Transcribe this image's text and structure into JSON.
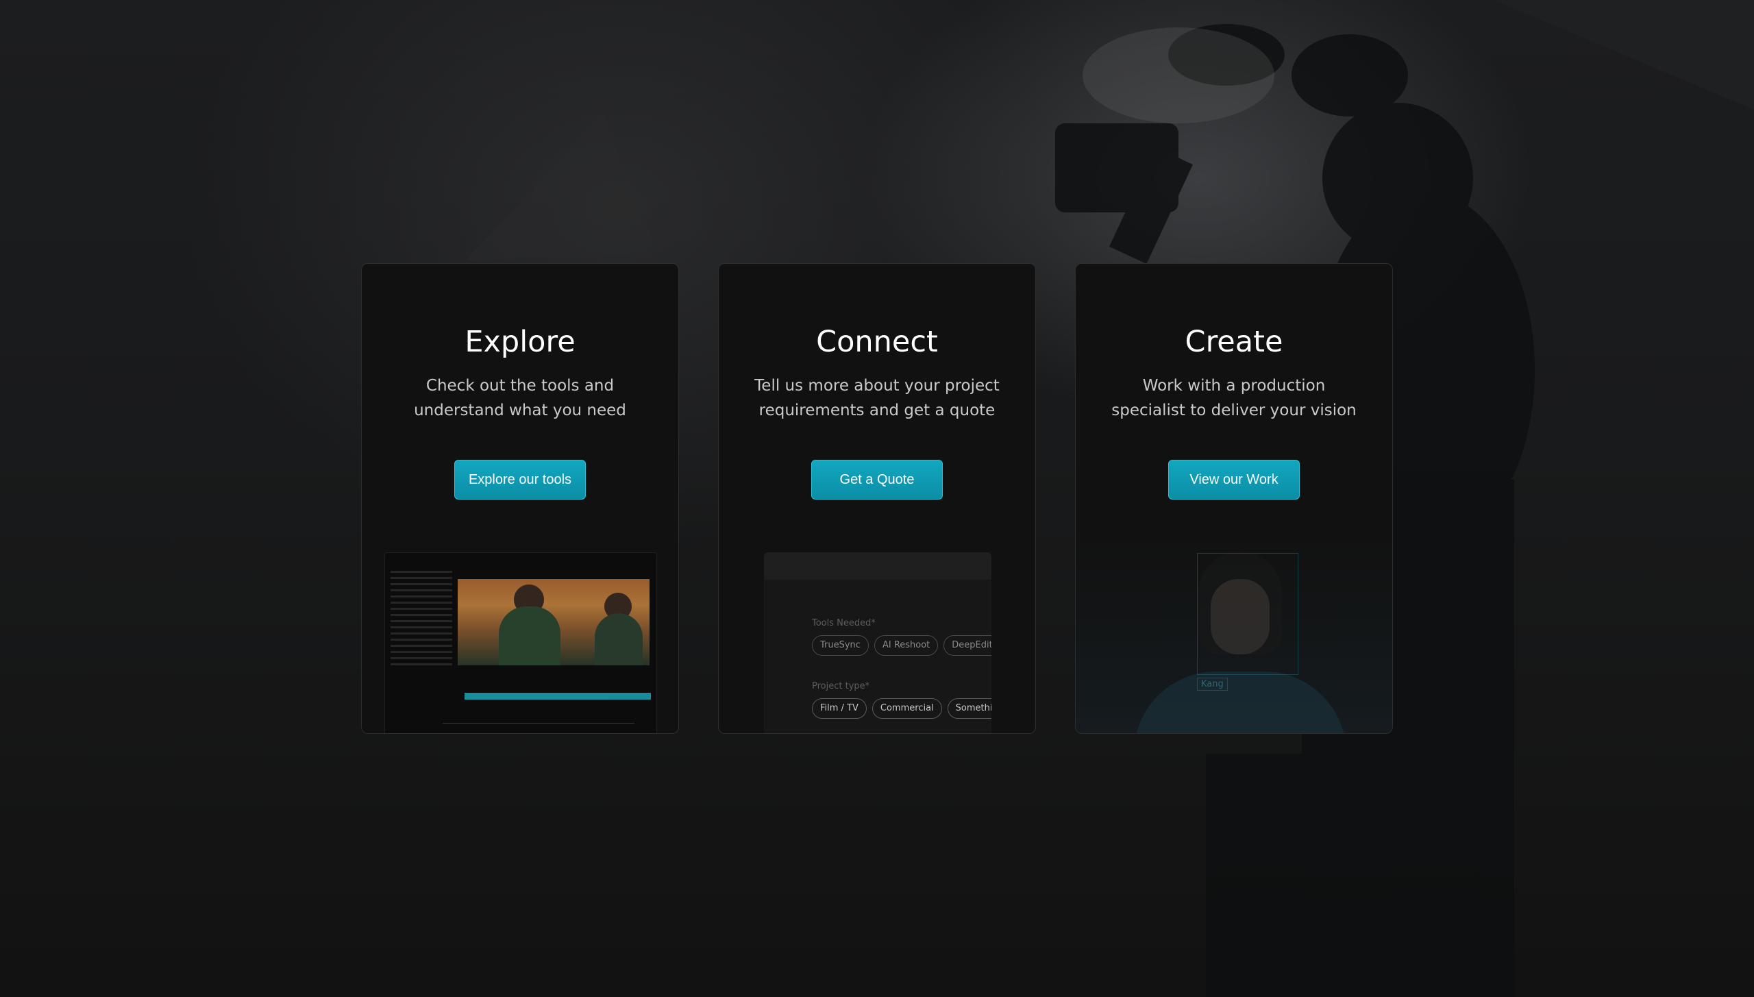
{
  "cards": [
    {
      "title": "Explore",
      "description": "Check out the tools and understand what you need",
      "button_label": "Explore our tools"
    },
    {
      "title": "Connect",
      "description": "Tell us more about your project requirements and get a quote",
      "button_label": "Get a Quote"
    },
    {
      "title": "Create",
      "description": "Work with a production specialist to deliver your vision",
      "button_label": "View our Work"
    }
  ],
  "quote_form_preview": {
    "tools_label": "Tools Needed*",
    "tools": [
      "TrueSync",
      "AI Reshoot",
      "DeepEditor"
    ],
    "project_type_label": "Project type*",
    "project_types": [
      "Film / TV",
      "Commercial",
      "Something"
    ]
  },
  "face_preview": {
    "tag": "Kang"
  },
  "colors": {
    "accent": "#0fa3bb",
    "card_background": "#111111",
    "page_background": "#141414"
  }
}
